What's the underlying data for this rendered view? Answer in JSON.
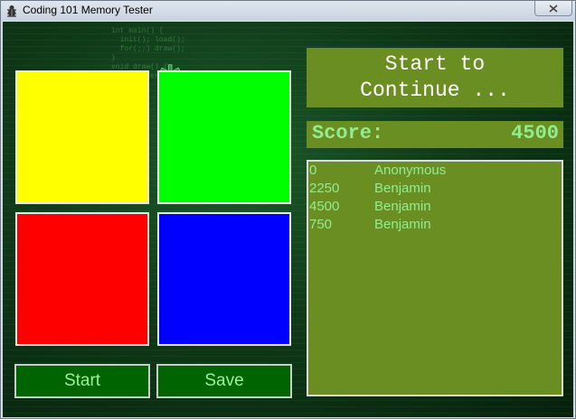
{
  "window": {
    "title": "Coding 101 Memory Tester",
    "close_icon": "close-icon",
    "app_icon": "bug-icon"
  },
  "colors": {
    "yellow": "#ffff00",
    "green": "#00ff00",
    "red": "#ff0000",
    "blue": "#0000ff",
    "panel": "#6b8e23",
    "panel_text": "#90ee90",
    "button_bg": "#006400"
  },
  "message": {
    "line1": "Start to",
    "line2": "Continue ..."
  },
  "score": {
    "label": "Score:",
    "value": "4500"
  },
  "leaderboard": [
    {
      "score": "0",
      "name": "Anonymous"
    },
    {
      "score": "2250",
      "name": "Benjamin"
    },
    {
      "score": "4500",
      "name": "Benjamin"
    },
    {
      "score": "750",
      "name": "Benjamin"
    }
  ],
  "buttons": {
    "start": "Start",
    "save": "Save"
  }
}
